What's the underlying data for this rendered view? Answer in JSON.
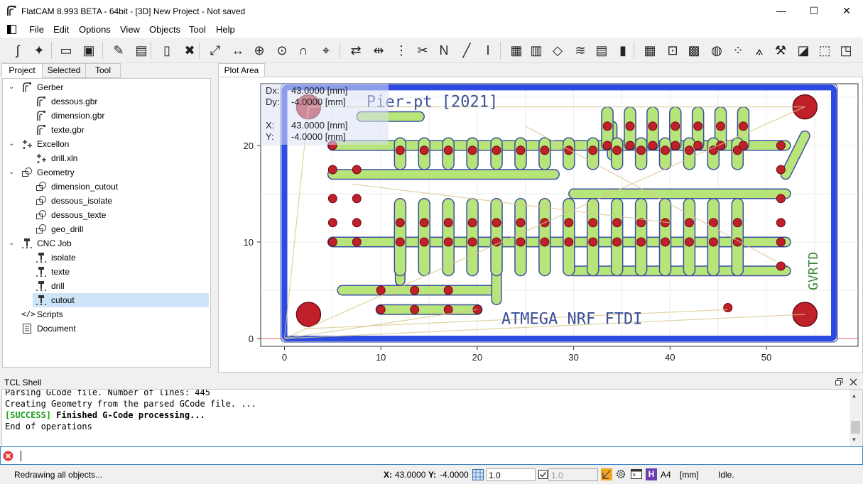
{
  "window": {
    "title": "FlatCAM 8.993 BETA - 64bit - [3D]   New Project - Not saved",
    "minimize_glyph": "—",
    "maximize_glyph": "☐",
    "close_glyph": "✕"
  },
  "menu": [
    "File",
    "Edit",
    "Options",
    "View",
    "Objects",
    "Tool",
    "Help"
  ],
  "toolbar_icons": [
    "open-gerber-icon",
    "open-excellon-icon",
    "open-project-icon",
    "save-project-icon",
    "new-geometry-icon",
    "new-excellon-icon",
    "new-document-icon",
    "delete-icon",
    "zoom-fit-icon",
    "distance-icon",
    "origin-icon",
    "jump-to-icon",
    "snap-icon",
    "locate-icon",
    "flip-icon",
    "align-icon",
    "multi-align-icon",
    "cut-icon",
    "ncc-icon",
    "paint-icon",
    "isolation-icon",
    "panelize-icon",
    "film-icon",
    "solderpaste-icon",
    "sub-icon",
    "rules-icon",
    "optimal-icon",
    "calculator-icon",
    "crop-icon",
    "qrcode-icon",
    "copper-fill-icon",
    "fiducials-icon",
    "calibration-icon",
    "punch-icon",
    "invert-icon",
    "extract-icon",
    "corners-icon",
    "etch-compensation-icon"
  ],
  "left_tabs": [
    "Project",
    "Selected",
    "Tool"
  ],
  "tree": {
    "gerber": "Gerber",
    "gerber_items": [
      "dessous.gbr",
      "dimension.gbr",
      "texte.gbr"
    ],
    "excellon": "Excellon",
    "excellon_items": [
      "drill.xln"
    ],
    "geometry": "Geometry",
    "geometry_items": [
      "dimension_cutout",
      "dessous_isolate",
      "dessous_texte",
      "geo_drill"
    ],
    "cnc": "CNC Job",
    "cnc_items": [
      "isolate",
      "texte",
      "drill",
      "cutout"
    ],
    "scripts": "Scripts",
    "document": "Document"
  },
  "plot": {
    "tab": "Plot Area",
    "dx_label": "Dx:",
    "dx_value": "43.0000 [mm]",
    "dy_label": "Dy:",
    "dy_value": "-4.0000 [mm]",
    "x_label": "X:",
    "x_value": "43.0000 [mm]",
    "y_label": "Y:",
    "y_value": "-4.0000 [mm]",
    "x_ticks": [
      "0",
      "10",
      "20",
      "30",
      "40",
      "50"
    ],
    "y_ticks": [
      "0",
      "10",
      "20"
    ],
    "board_text_top": "Pier-pt [2021]",
    "board_text_bottom": "ATMEGA  NRF  FTDI",
    "board_text_side": "GVRTD",
    "colors": {
      "outline": "#2d4be0",
      "trace": "#b8e57a",
      "trace_edge": "#3c4fa0",
      "pad": "#c0202a",
      "label": "#8b0000",
      "cut": "#d8c88a"
    }
  },
  "shell": {
    "title": "TCL Shell",
    "line1": "Parsing GCode file. Number of lines: 445",
    "line2": "Creating Geometry from the parsed GCode file. ...",
    "line3_tag": "[SUCCESS]",
    "line3_text": " Finished G-Code processing...",
    "line4": "End of operations"
  },
  "status": {
    "message": "Redrawing all objects...",
    "x_label": "X:",
    "x_value": "43.0000",
    "y_label": "Y:",
    "y_value": "-4.0000",
    "grid_x": "1.0",
    "grid_y": "1.0",
    "paper": "A4",
    "units": "[mm]",
    "state": "Idle."
  }
}
